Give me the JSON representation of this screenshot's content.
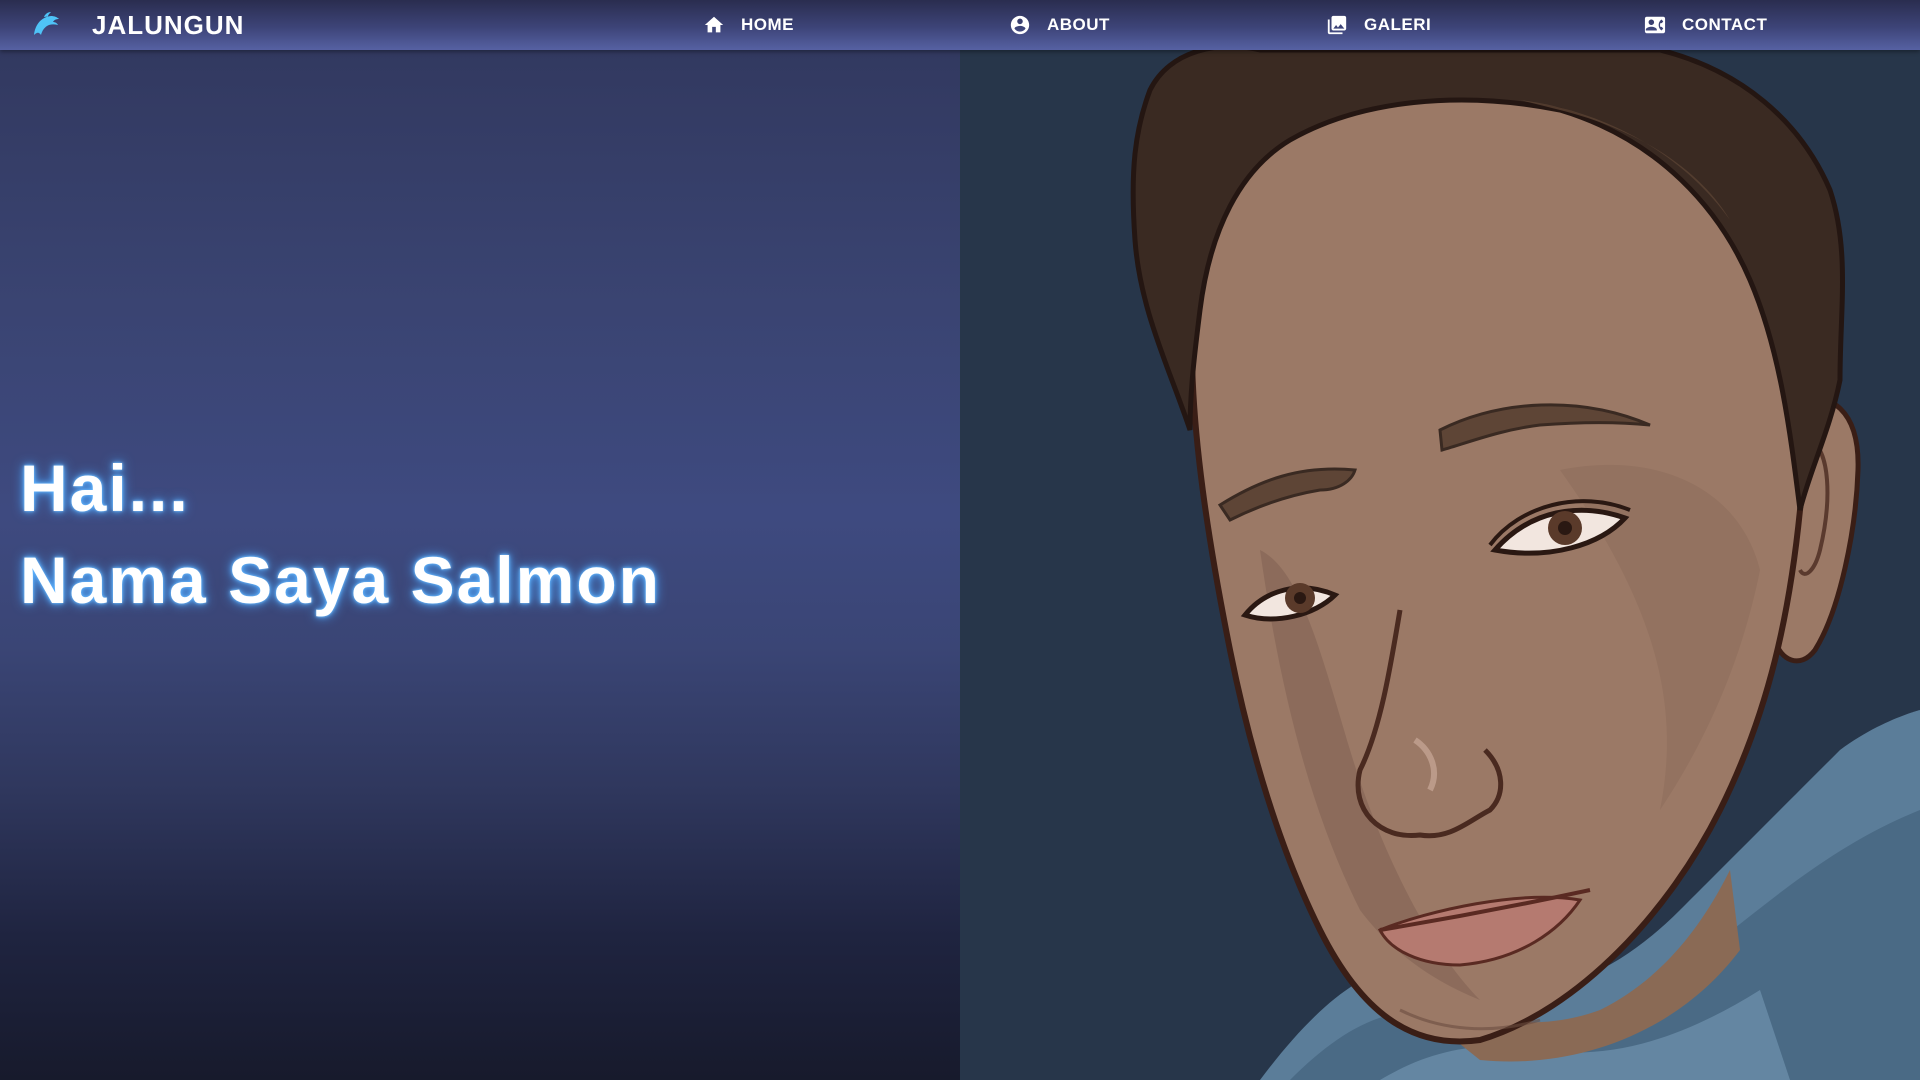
{
  "navbar": {
    "brand": {
      "name": "JALUNGUN",
      "logo_icon": "dolphin-icon"
    },
    "items": [
      {
        "label": "HOME",
        "icon": "home-icon"
      },
      {
        "label": "ABOUT",
        "icon": "account-circle-icon"
      },
      {
        "label": "GALERI",
        "icon": "photo-library-icon"
      },
      {
        "label": "CONTACT",
        "icon": "contact-card-icon"
      }
    ]
  },
  "hero": {
    "greeting": "Hai...",
    "intro": "Nama Saya Salmon"
  },
  "colors": {
    "brand_logo": "#4fc3f7",
    "text": "#ffffff",
    "text_glow": "#5fb6ff",
    "navbar_top": "#2a2d4f",
    "navbar_bottom": "#5661a3",
    "portrait_background": "#27364a"
  }
}
